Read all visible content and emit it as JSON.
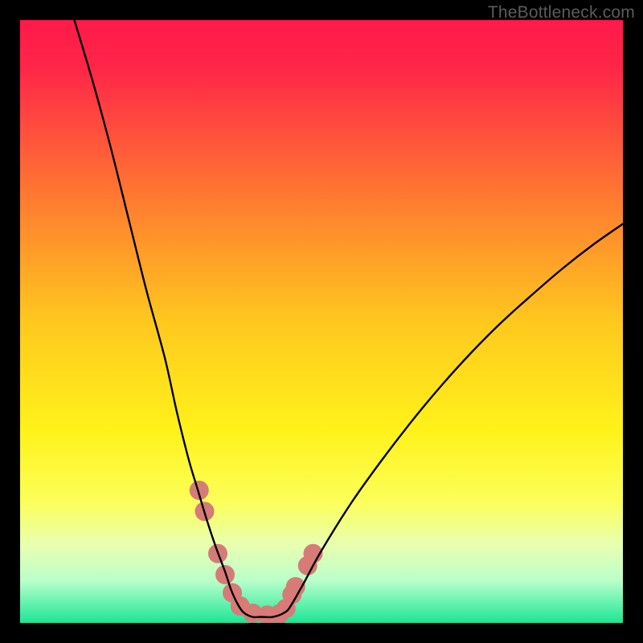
{
  "watermark": "TheBottleneck.com",
  "chart_data": {
    "type": "line",
    "title": "",
    "xlabel": "",
    "ylabel": "",
    "xlim": [
      0,
      100
    ],
    "ylim": [
      0,
      100
    ],
    "grid": false,
    "legend": false,
    "background_gradient": {
      "stops": [
        {
          "offset": 0.0,
          "color": "#ff1a4a"
        },
        {
          "offset": 0.08,
          "color": "#ff2648"
        },
        {
          "offset": 0.3,
          "color": "#ff7c30"
        },
        {
          "offset": 0.5,
          "color": "#ffc81e"
        },
        {
          "offset": 0.68,
          "color": "#fff21a"
        },
        {
          "offset": 0.8,
          "color": "#fcff5a"
        },
        {
          "offset": 0.87,
          "color": "#e9ffb0"
        },
        {
          "offset": 0.93,
          "color": "#b9ffca"
        },
        {
          "offset": 1.0,
          "color": "#1be695"
        }
      ]
    },
    "series": [
      {
        "name": "bottleneck-curve",
        "color": "#000000",
        "x": [
          9,
          12,
          15,
          18,
          21,
          24,
          26,
          28,
          29.5,
          31,
          32.5,
          34,
          35,
          36,
          37,
          38.5,
          40,
          42,
          44,
          45,
          47,
          50,
          55,
          60,
          65,
          70,
          75,
          80,
          85,
          90,
          95,
          100
        ],
        "y": [
          100,
          90,
          79,
          67,
          55,
          44,
          35,
          27,
          22,
          17,
          12.5,
          8.5,
          5.5,
          3.3,
          1.8,
          1.0,
          1.0,
          1.0,
          1.8,
          3.0,
          6.5,
          12,
          20,
          27,
          33.5,
          39.5,
          45,
          50,
          54.5,
          58.8,
          62.7,
          66.2
        ]
      }
    ],
    "markers": {
      "name": "hotspots",
      "color": "#d67b78",
      "radius": 12,
      "points": [
        {
          "x": 29.7,
          "y": 22.0
        },
        {
          "x": 30.6,
          "y": 18.5
        },
        {
          "x": 32.8,
          "y": 11.5
        },
        {
          "x": 34.0,
          "y": 8.0
        },
        {
          "x": 35.2,
          "y": 5.0
        },
        {
          "x": 36.5,
          "y": 2.8
        },
        {
          "x": 38.6,
          "y": 1.6
        },
        {
          "x": 41.0,
          "y": 1.3
        },
        {
          "x": 43.0,
          "y": 1.5
        },
        {
          "x": 44.1,
          "y": 2.4
        },
        {
          "x": 45.1,
          "y": 4.7
        },
        {
          "x": 45.7,
          "y": 6.0
        },
        {
          "x": 47.7,
          "y": 9.5
        },
        {
          "x": 48.6,
          "y": 11.5
        }
      ]
    }
  }
}
